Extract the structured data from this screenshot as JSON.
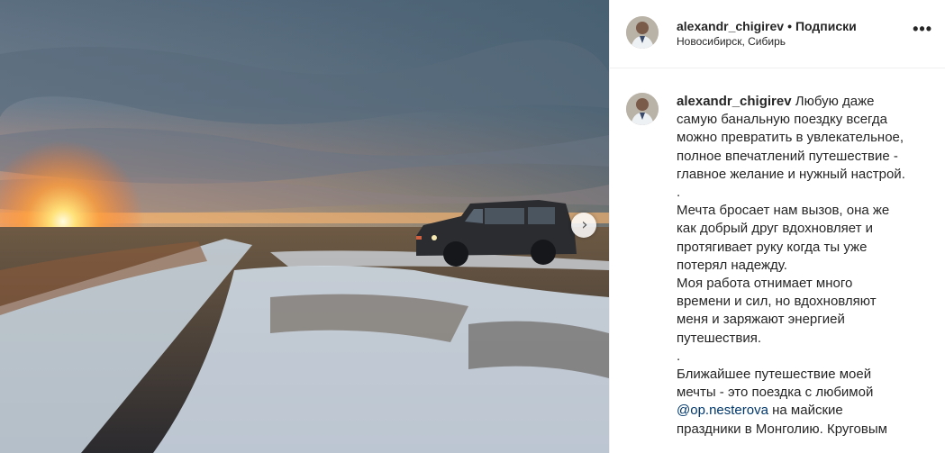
{
  "header": {
    "username": "alexandr_chigirev",
    "separator": "•",
    "follow_label": "Подписки",
    "location": "Новосибирск, Сибирь",
    "more_icon": "more-horizontal-icon"
  },
  "photo": {
    "description_icon": "carousel-next-icon",
    "next_glyph": "›"
  },
  "caption": {
    "username": "alexandr_chigirev",
    "line1": "Любую даже",
    "lines": [
      "самую банальную поездку всегда",
      "можно превратить в увлекательное,",
      "полное впечатлений путешествие -",
      "главное желание и нужный настрой.",
      ".",
      "Мечта бросает нам вызов, она же",
      "как добрый друг вдохновляет и",
      "протягивает руку когда ты уже",
      "потерял надежду.",
      "Моя работа отнимает много",
      "времени и сил, но вдохновляют",
      "меня и заряжают энергией",
      "путешествия.",
      ".",
      "Ближайшее путешествие моей",
      "мечты - это поездка с любимой"
    ],
    "mention": "@op.nesterova",
    "after_mention": " на майские",
    "last_line": "праздники в Монголию. Круговым"
  },
  "colors": {
    "link": "#00376b",
    "border": "#efefef"
  }
}
